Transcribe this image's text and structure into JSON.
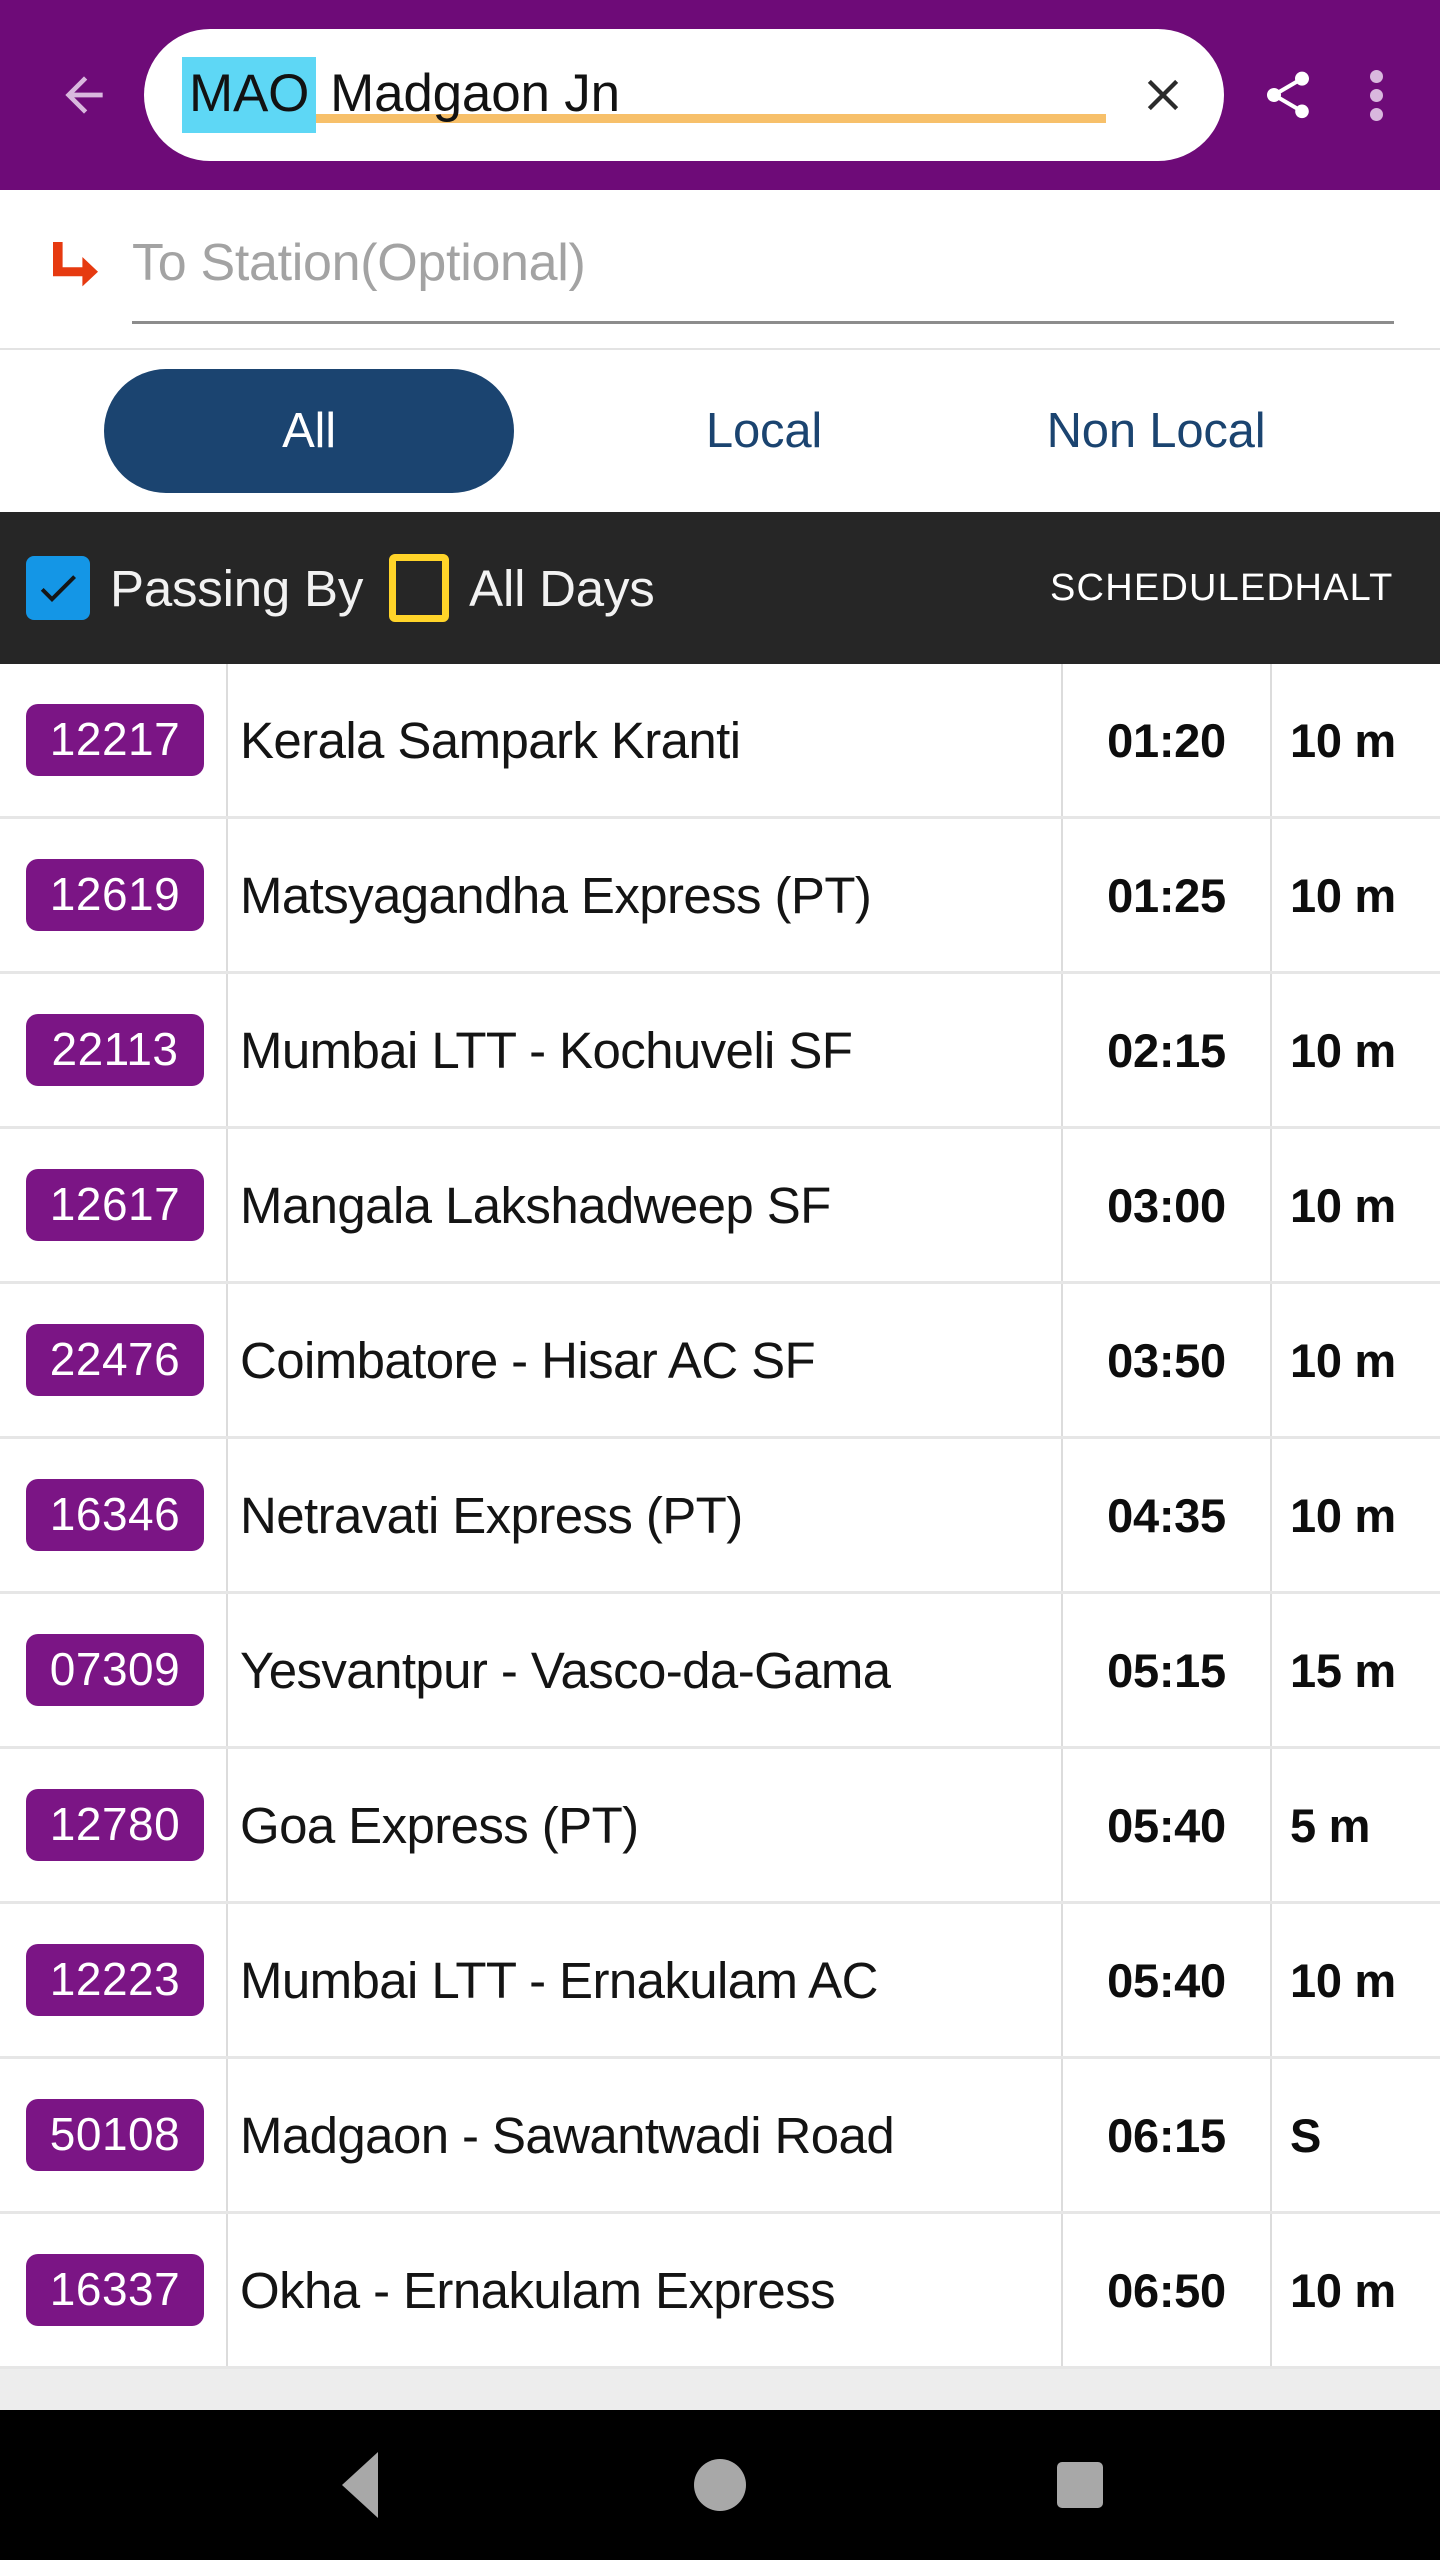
{
  "appbar": {
    "back_icon": "arrow-left-icon",
    "search": {
      "station_code": "MAO",
      "station_name": "Madgaon Jn",
      "clear_icon": "close-icon"
    },
    "share_icon": "share-icon",
    "overflow_icon": "more-vertical-icon"
  },
  "to_station": {
    "arrow_icon": "corner-down-right-arrow-icon",
    "placeholder": "To Station(Optional)",
    "value": ""
  },
  "tabs": [
    {
      "label": "All",
      "active": true
    },
    {
      "label": "Local",
      "active": false
    },
    {
      "label": "Non Local",
      "active": false
    }
  ],
  "filter_bar": {
    "passing_by": {
      "label": "Passing By",
      "checked": true,
      "icon": "checkbox-checked-icon"
    },
    "all_days": {
      "label": "All Days",
      "checked": false,
      "icon": "checkbox-empty-icon"
    },
    "columns": {
      "scheduled": "SCHEDULED",
      "halt": "HALT"
    }
  },
  "trains": [
    {
      "number": "12217",
      "name": "Kerala Sampark Kranti",
      "scheduled": "01:20",
      "halt": "10 m"
    },
    {
      "number": "12619",
      "name": "Matsyagandha Express (PT)",
      "scheduled": "01:25",
      "halt": "10 m"
    },
    {
      "number": "22113",
      "name": "Mumbai LTT - Kochuveli SF",
      "scheduled": "02:15",
      "halt": "10 m"
    },
    {
      "number": "12617",
      "name": "Mangala Lakshadweep SF",
      "scheduled": "03:00",
      "halt": "10 m"
    },
    {
      "number": "22476",
      "name": "Coimbatore - Hisar AC SF",
      "scheduled": "03:50",
      "halt": "10 m"
    },
    {
      "number": "16346",
      "name": "Netravati Express (PT)",
      "scheduled": "04:35",
      "halt": "10 m"
    },
    {
      "number": "07309",
      "name": "Yesvantpur - Vasco-da-Gama",
      "scheduled": "05:15",
      "halt": "15 m"
    },
    {
      "number": "12780",
      "name": "Goa Express (PT)",
      "scheduled": "05:40",
      "halt": "5 m"
    },
    {
      "number": "12223",
      "name": "Mumbai LTT - Ernakulam AC",
      "scheduled": "05:40",
      "halt": "10 m"
    },
    {
      "number": "50108",
      "name": "Madgaon - Sawantwadi Road",
      "scheduled": "06:15",
      "halt": "S"
    },
    {
      "number": "16337",
      "name": "Okha - Ernakulam Express",
      "scheduled": "06:50",
      "halt": "10 m"
    }
  ],
  "navbar": {
    "back_icon": "triangle-back-icon",
    "home_icon": "circle-home-icon",
    "recents_icon": "square-recents-icon"
  },
  "colors": {
    "appbar_purple": "#6E0B78",
    "badge_purple": "#7B1585",
    "tab_blue": "#1B4470",
    "filterbar_dark": "#262626",
    "checkbox_blue": "#1496E6",
    "checkbox_yellow": "#FFD429",
    "highlight_cyan": "#5ED7F5",
    "underline_orange": "#F7C06A",
    "arrow_orange": "#E63A10"
  }
}
